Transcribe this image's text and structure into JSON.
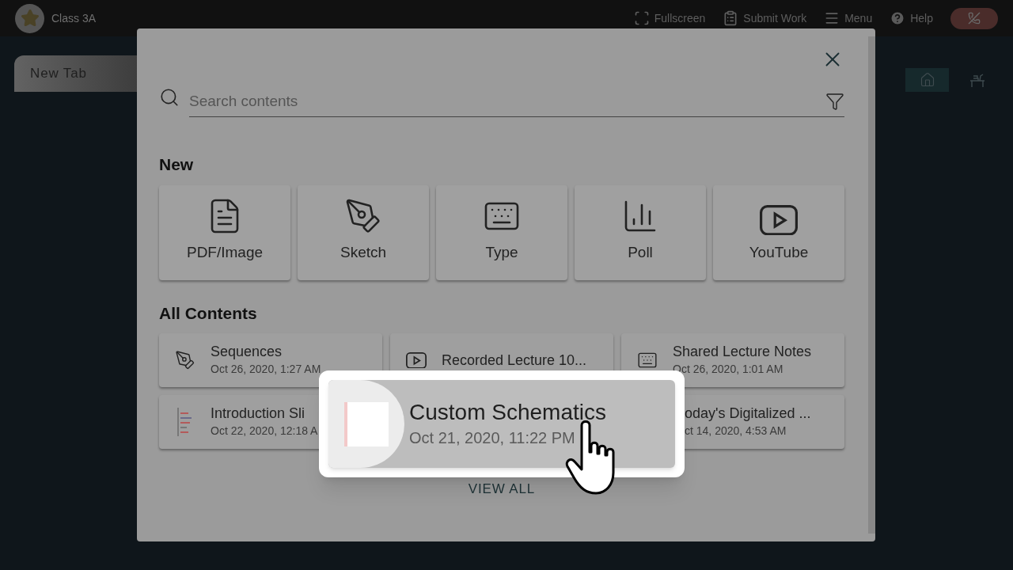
{
  "top_bar": {
    "class_name": "Class 3A",
    "actions": [
      {
        "kind": "fullscreen",
        "label": "Fullscreen"
      },
      {
        "kind": "submit",
        "label": "Submit Work"
      },
      {
        "kind": "menu",
        "label": "Menu"
      },
      {
        "kind": "help",
        "label": "Help"
      }
    ]
  },
  "tabs": [
    {
      "label": "New Tab",
      "selected": true
    }
  ],
  "side_tools": [
    {
      "kind": "home",
      "selected": true
    },
    {
      "kind": "desk",
      "selected": false
    }
  ],
  "dialog": {
    "search": {
      "placeholder": "Search contents"
    },
    "new_section": {
      "title": "New",
      "items": [
        {
          "kind": "pdf",
          "label": "PDF/Image"
        },
        {
          "kind": "sketch",
          "label": "Sketch"
        },
        {
          "kind": "type",
          "label": "Type"
        },
        {
          "kind": "poll",
          "label": "Poll"
        },
        {
          "kind": "video",
          "label": "YouTube"
        }
      ]
    },
    "all_section": {
      "title": "All Contents",
      "items": [
        {
          "kind": "sketch",
          "title": "Sequences",
          "date": "Oct 26, 2020, 1:27 AM",
          "highlighted": false
        },
        {
          "kind": "video",
          "title": "Recorded Lecture 10...",
          "highlighted": false
        },
        {
          "kind": "type",
          "title": "Shared Lecture Notes",
          "date": "Oct 26, 2020, 1:01 AM",
          "highlighted": false
        },
        {
          "kind": "slides",
          "title": "Introduction Sli",
          "date": "Oct 22, 2020, 12:18 A",
          "highlighted": false
        },
        {
          "kind": "thumbnail",
          "title": "Custom Schematics",
          "date": "Oct 21, 2020, 11:22 PM",
          "highlighted": true
        },
        {
          "kind": "covered",
          "title": "oday's Digitalized ...",
          "date": "ct 14, 2020, 4:53 AM",
          "highlighted": false
        }
      ]
    },
    "view_all": "VIEW ALL"
  }
}
